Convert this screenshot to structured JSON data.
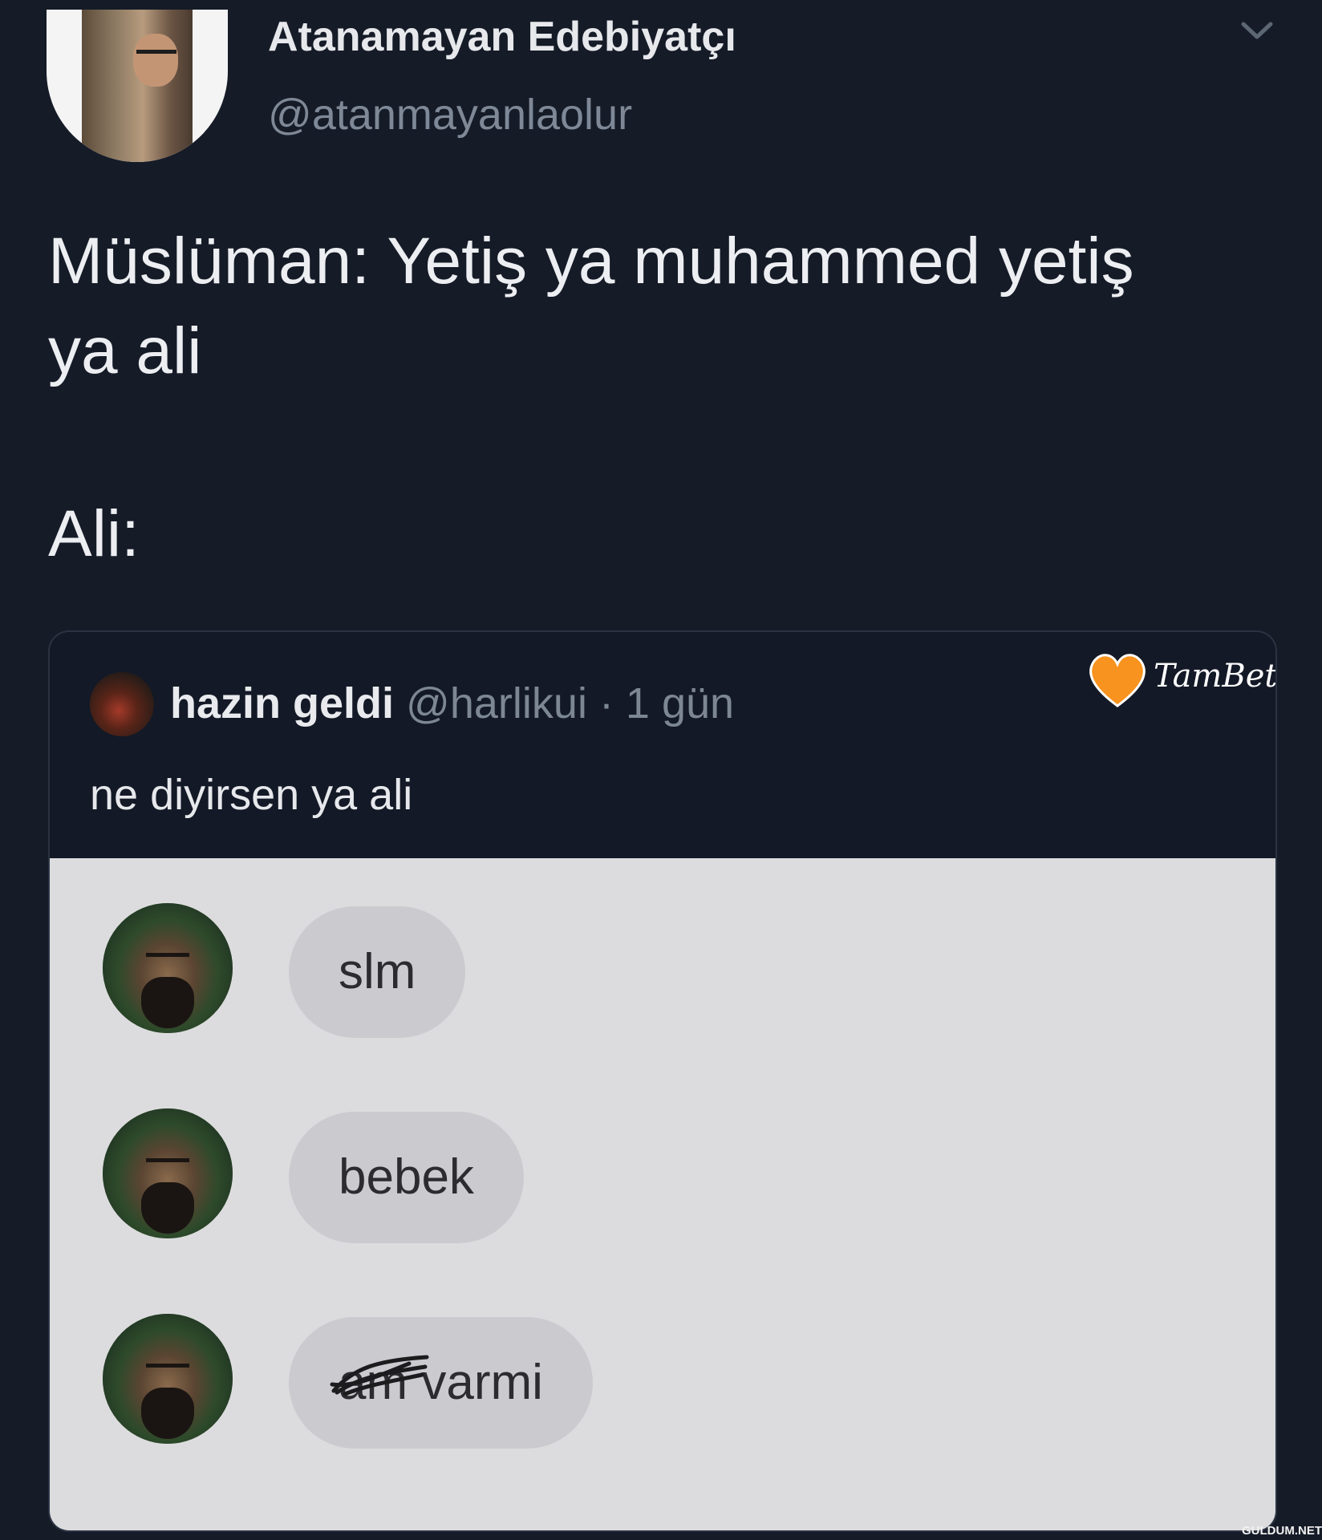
{
  "tweet": {
    "display_name": "Atanamayan Edebiyatçı",
    "handle": "@atanmayanlaolur",
    "text_lines": [
      "Müslüman: Yetiş ya muhammed yetiş",
      "ya ali"
    ],
    "text_line_after": "Ali:",
    "chevron_icon": "chevron-down-icon"
  },
  "quote": {
    "name": "hazin geldi",
    "handle_time": "@harlikui · 1 gün",
    "text": "ne diyirsen ya ali",
    "logo_text": "TamBet",
    "logo_color": "#f7931e"
  },
  "chat": {
    "messages": [
      {
        "text": "slm"
      },
      {
        "text": "bebek"
      },
      {
        "scribbled_text": "am",
        "text": "varmi"
      }
    ]
  },
  "watermark": "GULDUM.NET"
}
